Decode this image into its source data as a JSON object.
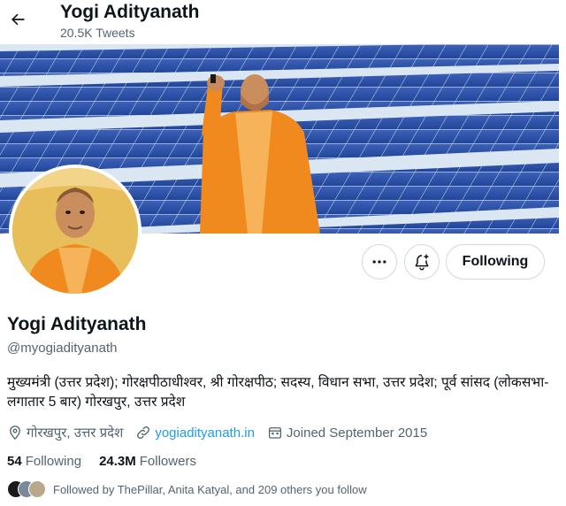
{
  "header": {
    "name": "Yogi Adityanath",
    "tweet_count": "20.5K Tweets"
  },
  "profile": {
    "display_name": "Yogi Adityanath",
    "handle": "@myogiadityanath",
    "bio": "मुख्यमंत्री (उत्तर प्रदेश); गोरक्षपीठाधीश्वर, श्री गोरक्षपीठ; सदस्य, विधान सभा, उत्तर प्रदेश; पूर्व सांसद (लोकसभा-लगातार 5 बार) गोरखपुर, उत्तर प्रदेश",
    "location": "गोरखपुर, उत्तर प्रदेश",
    "website": "yogiadityanath.in",
    "joined": "Joined September 2015"
  },
  "actions": {
    "following_label": "Following"
  },
  "stats": {
    "following_count": "54",
    "following_label": "Following",
    "followers_count": "24.3M",
    "followers_label": "Followers"
  },
  "followed_by": {
    "text": "Followed by ThePillar, Anita Katyal, and 209 others you follow"
  },
  "icons": {
    "back": "arrow-left-icon",
    "more": "more-horizontal-icon",
    "notify": "bell-plus-icon",
    "location": "location-pin-icon",
    "link": "link-icon",
    "calendar": "calendar-icon"
  },
  "colors": {
    "text_primary": "#0f1419",
    "text_secondary": "#536471",
    "link": "#1d9bf0",
    "border": "#cfd9de",
    "saffron": "#f08a1e"
  }
}
